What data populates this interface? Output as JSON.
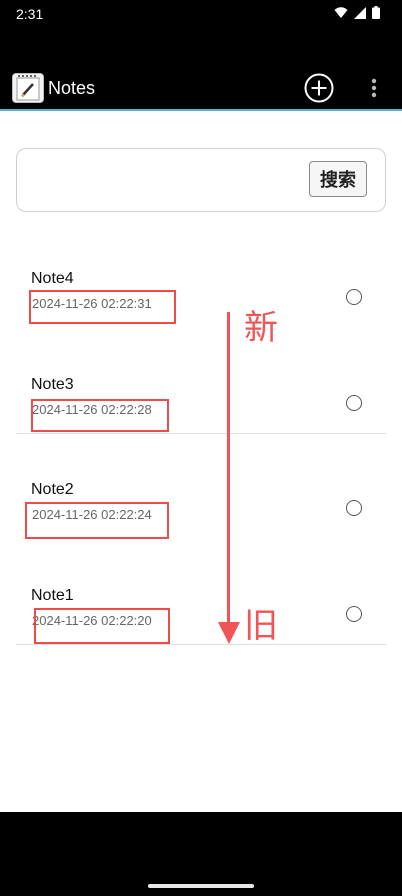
{
  "status_bar": {
    "time": "2:31"
  },
  "app_bar": {
    "title": "Notes"
  },
  "search": {
    "value": "",
    "button_label": "搜索"
  },
  "notes": [
    {
      "title": "Note4",
      "time": "2024-11-26 02:22:31",
      "selected": false
    },
    {
      "title": "Note3",
      "time": "2024-11-26 02:22:28",
      "selected": false
    },
    {
      "title": "Note2",
      "time": "2024-11-26 02:22:24",
      "selected": false
    },
    {
      "title": "Note1",
      "time": "2024-11-26 02:22:20",
      "selected": false
    }
  ],
  "annotation": {
    "newest_label": "新",
    "oldest_label": "旧",
    "accent_color": "#f05555"
  },
  "colors": {
    "app_bar_accent": "#4fb3d8",
    "highlight": "#ef4b4b"
  }
}
